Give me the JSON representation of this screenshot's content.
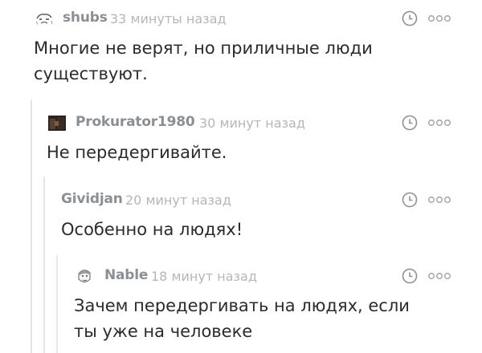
{
  "comments": [
    {
      "author": "shubs",
      "time": "33 минуты назад",
      "text": "Многие не верят, но приличные люди существуют.",
      "avatar_icon": "avatar-sketch-icon"
    },
    {
      "author": "Prokurator1980",
      "time": "30 минут назад",
      "text": "Не передергивайте.",
      "avatar_icon": "avatar-photo-icon"
    },
    {
      "author": "Gividjan",
      "time": "20 минут назад",
      "text": "Особенно на людях!",
      "avatar_icon": "none"
    },
    {
      "author": "Nable",
      "time": "18 минут назад",
      "text": "Зачем передергивать на людях, если ты уже на человеке",
      "avatar_icon": "avatar-face-icon"
    }
  ],
  "icons": {
    "clock": "clock-icon",
    "more": "more-dots-icon"
  },
  "colors": {
    "author": "#8b8e92",
    "timestamp": "#b3b6ba",
    "text": "#2a2b2d",
    "thread_line": "#e1e3e6"
  }
}
